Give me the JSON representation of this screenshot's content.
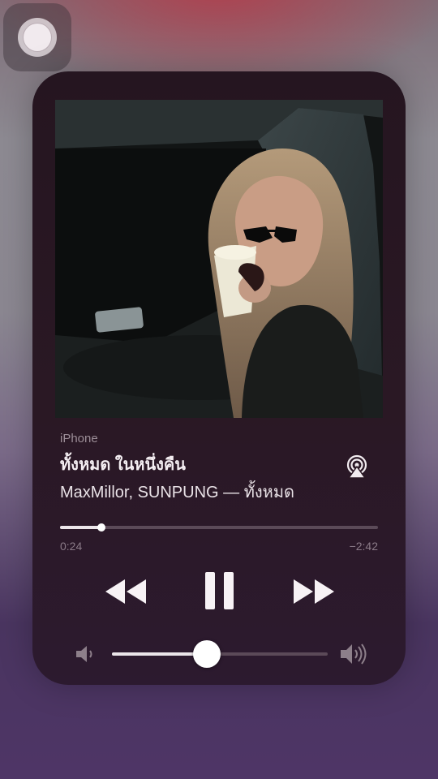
{
  "now_playing": {
    "source": "iPhone",
    "title": "ทั้งหมด ในหนึ่งคืน",
    "subtitle": "MaxMillor, SUNPUNG — ทั้งหมด",
    "elapsed": "0:24",
    "remaining": "−2:42",
    "progress_fraction": 0.129,
    "volume_fraction": 0.44
  },
  "icons": {
    "assistive_touch": "assistive-touch-icon",
    "airplay": "airplay-audio-icon",
    "rewind": "rewind-icon",
    "pause": "pause-icon",
    "fast_forward": "fast-forward-icon",
    "volume_low": "speaker-low-icon",
    "volume_high": "speaker-high-icon"
  },
  "colors": {
    "card_bg": "#251520",
    "accent_text": "#f4eef2",
    "secondary_text": "#9c8e98",
    "track": "#5b4a58",
    "fill": "#ece6ea"
  }
}
